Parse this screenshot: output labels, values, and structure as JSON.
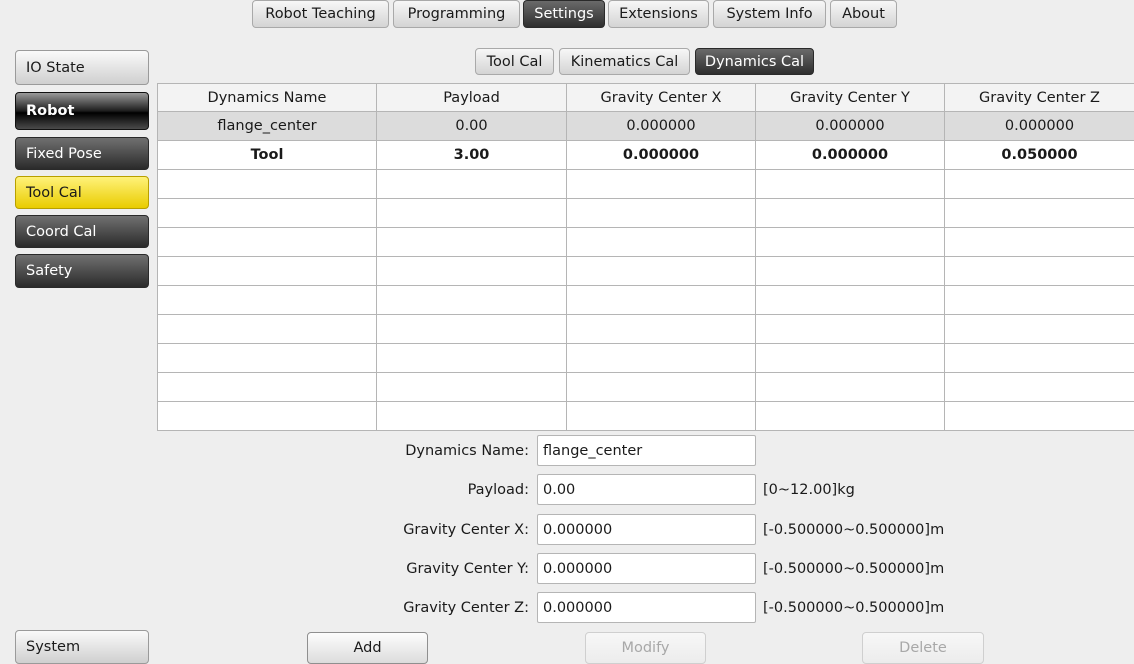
{
  "top_tabs": [
    "Robot Teaching",
    "Programming",
    "Settings",
    "Extensions",
    "System Info",
    "About"
  ],
  "active_top_tab": "Settings",
  "sub_tabs": [
    "Tool Cal",
    "Kinematics Cal",
    "Dynamics Cal"
  ],
  "active_sub_tab": "Dynamics Cal",
  "sidebar": {
    "io_state": "IO State",
    "robot": "Robot",
    "fixed_pose": "Fixed Pose",
    "tool_cal": "Tool Cal",
    "coord_cal": "Coord Cal",
    "safety": "Safety",
    "system": "System"
  },
  "table": {
    "headers": [
      "Dynamics Name",
      "Payload",
      "Gravity Center X",
      "Gravity Center Y",
      "Gravity Center Z"
    ],
    "rows": [
      [
        "flange_center",
        "0.00",
        "0.000000",
        "0.000000",
        "0.000000"
      ],
      [
        "Tool",
        "3.00",
        "0.000000",
        "0.000000",
        "0.050000"
      ]
    ]
  },
  "form": {
    "name_label": "Dynamics Name:",
    "name_value": "flange_center",
    "payload_label": "Payload:",
    "payload_value": "0.00",
    "payload_range": "[0~12.00]kg",
    "gx_label": "Gravity Center X:",
    "gx_value": "0.000000",
    "gx_range": "[-0.500000~0.500000]m",
    "gy_label": "Gravity Center Y:",
    "gy_value": "0.000000",
    "gy_range": "[-0.500000~0.500000]m",
    "gz_label": "Gravity Center Z:",
    "gz_value": "0.000000",
    "gz_range": "[-0.500000~0.500000]m"
  },
  "buttons": {
    "add": "Add",
    "modify": "Modify",
    "delete": "Delete"
  }
}
